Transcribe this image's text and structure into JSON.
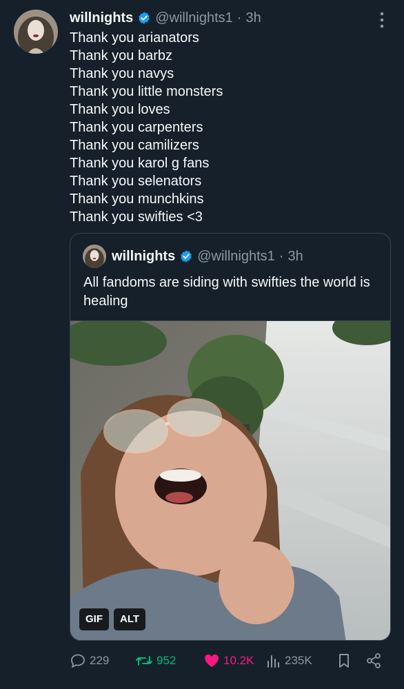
{
  "tweet": {
    "author_name": "willnights",
    "author_handle": "@willnights1",
    "separator": "·",
    "time": "3h",
    "verified_icon": "verified-badge-icon",
    "lines": [
      "Thank you arianators",
      "Thank you barbz",
      "Thank you navys",
      "Thank you little monsters",
      "Thank you loves",
      "Thank you carpenters",
      "Thank you camilizers",
      "Thank you karol g fans",
      "Thank you selenators",
      "Thank you munchkins",
      "Thank you swifties <3"
    ]
  },
  "quote": {
    "author_name": "willnights",
    "author_handle": "@willnights1",
    "separator": "·",
    "time": "3h",
    "text": "All fandoms are siding with swifties the world is healing",
    "media_badges": {
      "gif": "GIF",
      "alt": "ALT"
    }
  },
  "actions": {
    "replies": "229",
    "retweets": "952",
    "likes": "10.2K",
    "views": "235K"
  },
  "colors": {
    "background": "#15202b",
    "text": "#f7f9f9",
    "muted": "#8b98a5",
    "border": "#38444d",
    "verified": "#1d9bf0",
    "retweet": "#00ba7c",
    "like": "#f91880"
  }
}
